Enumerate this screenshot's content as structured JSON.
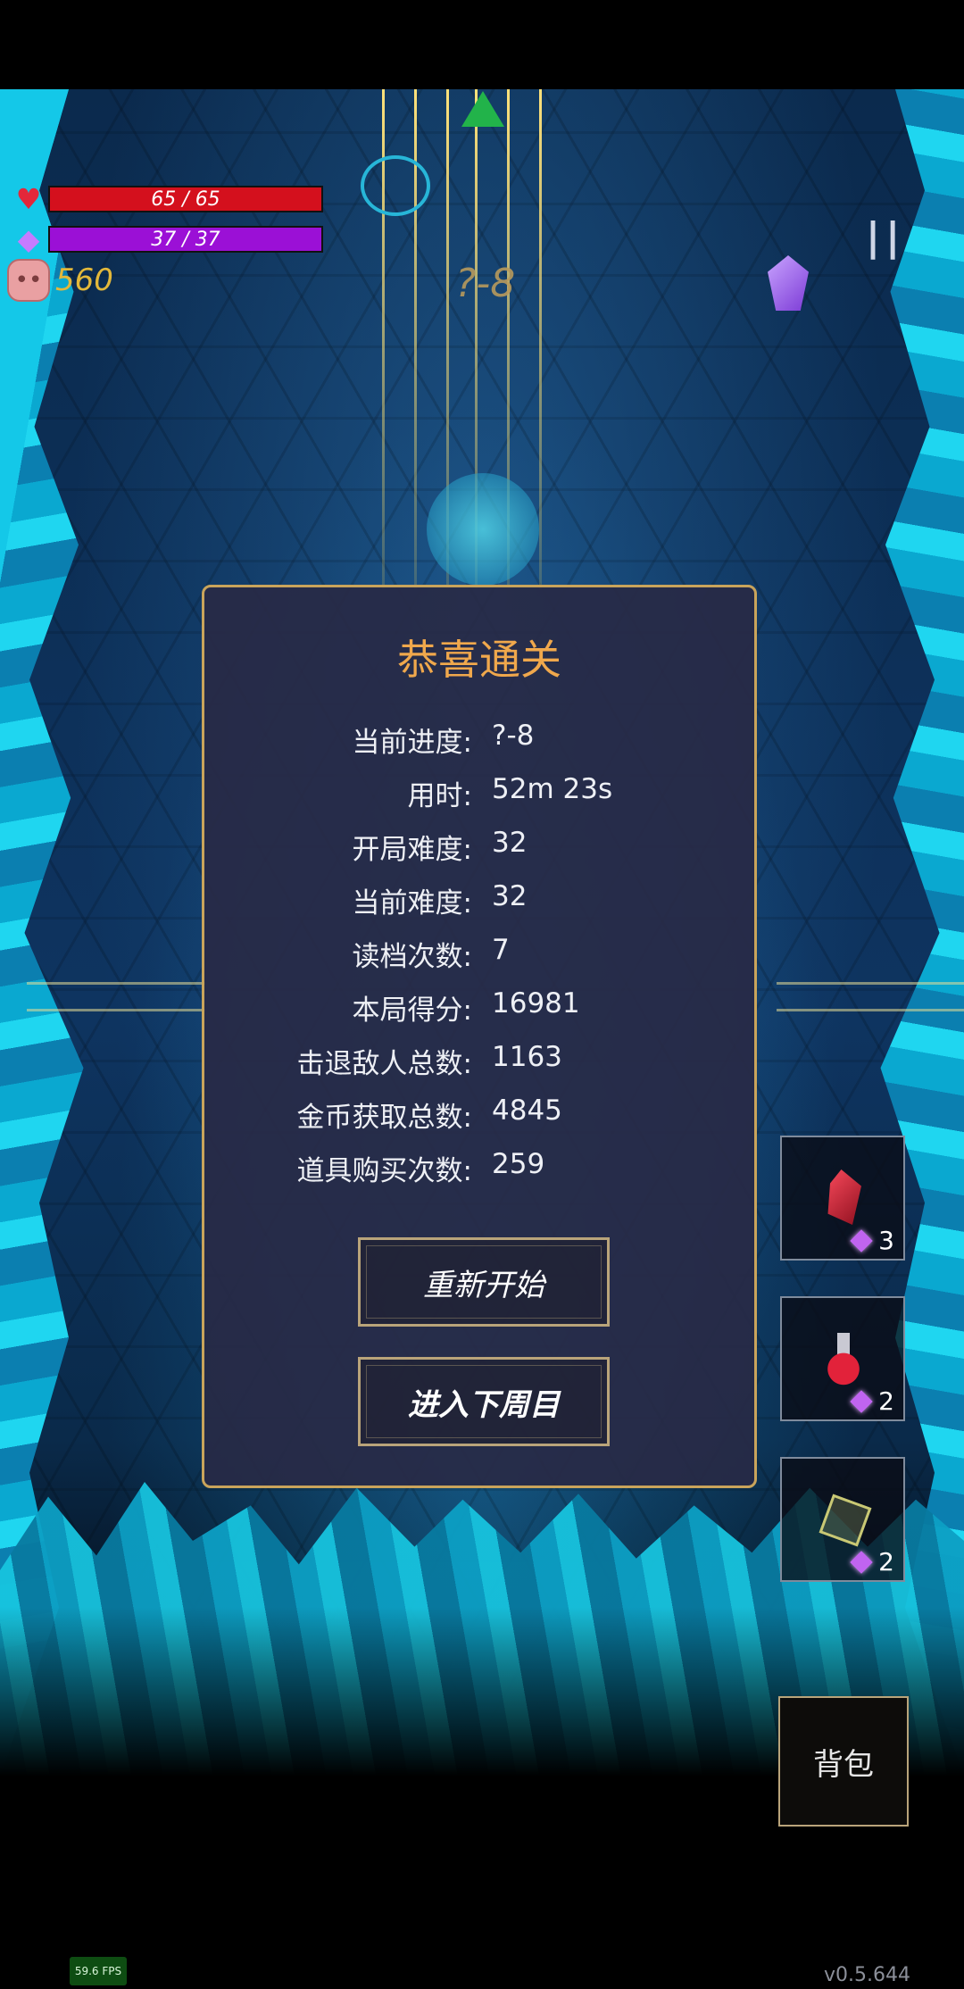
{
  "hud": {
    "hp": "65 / 65",
    "mp": "37 / 37",
    "coins": "560",
    "stage": "?-8",
    "pause_icon": "pause-icon",
    "heart_icon": "heart-icon",
    "mana_icon": "mana-gem-icon",
    "pig_icon": "pig-icon"
  },
  "dialog": {
    "title": "恭喜通关",
    "stats": [
      {
        "label": "当前进度:",
        "value": "?-8"
      },
      {
        "label": "用时:",
        "value": "52m 23s"
      },
      {
        "label": "开局难度:",
        "value": "32"
      },
      {
        "label": "当前难度:",
        "value": "32"
      },
      {
        "label": "读档次数:",
        "value": "7"
      },
      {
        "label": "本局得分:",
        "value": "16981"
      },
      {
        "label": "击退敌人总数:",
        "value": "1163"
      },
      {
        "label": "金币获取总数:",
        "value": "4845"
      },
      {
        "label": "道具购买次数:",
        "value": "259"
      }
    ],
    "restart_label": "重新开始",
    "next_cycle_label": "进入下周目"
  },
  "inventory": [
    {
      "icon": "red-crystal-icon",
      "cost": "3"
    },
    {
      "icon": "red-potion-icon",
      "cost": "2"
    },
    {
      "icon": "icosahedron-icon",
      "cost": "2"
    }
  ],
  "backpack_label": "背包",
  "fps": "59.6 FPS",
  "version": "v0.5.644",
  "colors": {
    "hp_bar": "#d4101d",
    "mp_bar": "#9b10d6",
    "coin_text": "#e3b83a",
    "dialog_title": "#f0a84c",
    "dialog_border": "#c9a45b"
  }
}
